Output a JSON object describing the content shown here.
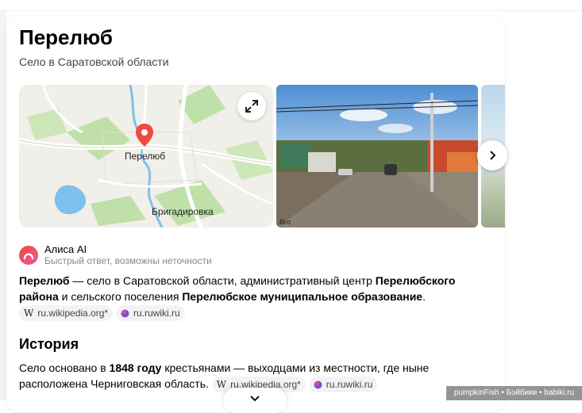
{
  "card": {
    "title": "Перелюб",
    "subtitle": "Село в Саратовской области"
  },
  "map": {
    "labels": {
      "main": "Перелюб",
      "village": "Бригадировка"
    }
  },
  "photo": {
    "signature": "Bro"
  },
  "alice": {
    "name": "Алиса AI",
    "note": "Быстрый ответ, возможны неточности"
  },
  "summary": {
    "b1": "Перелюб",
    "t1": " — село в Саратовской области, административный центр ",
    "b2": "Перелюбского района",
    "t2": " и сельского поселения ",
    "b3": "Перелюбское муниципальное образование",
    "t3": ".",
    "sources": [
      {
        "logo": "W",
        "label": "ru.wikipedia.org*"
      },
      {
        "logo": "ruwiki-icon",
        "label": "ru.ruwiki.ru"
      }
    ]
  },
  "history": {
    "heading": "История",
    "t1": "Село основано в ",
    "b1": "1848 году",
    "t2": " крестьянами — выходцами из местности, где ныне расположена Черниговская область.",
    "sources": [
      {
        "logo": "W",
        "label": "ru.wikipedia.org*"
      },
      {
        "logo": "ruwiki-icon",
        "label": "ru.ruwiki.ru"
      }
    ]
  },
  "watermark": "pumpkinFish • Бэйбики • babiki.ru",
  "colors": {
    "accent_red": "#f04a3d",
    "map_road": "#ffffff",
    "map_water": "#7fc0ec",
    "map_green": "#bfe0a8",
    "alice_gradient_start": "#f0493b",
    "alice_gradient_end": "#e85a9a"
  }
}
